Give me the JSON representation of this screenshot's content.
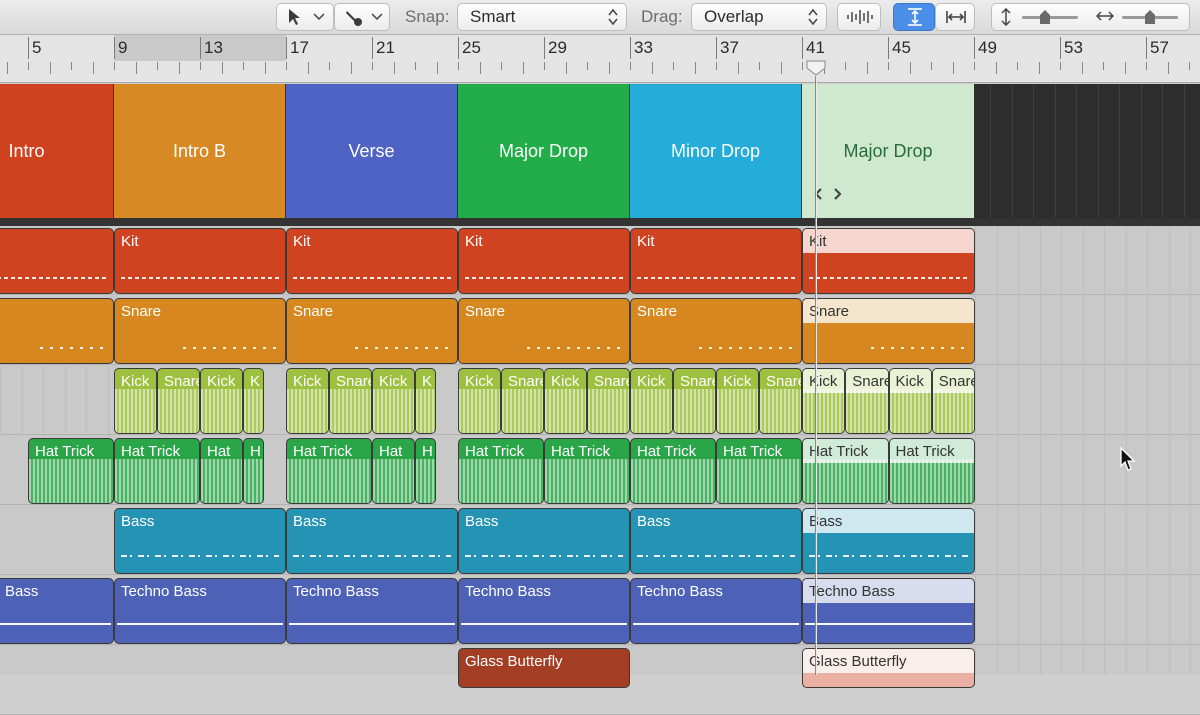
{
  "toolbar": {
    "snap_label": "Snap:",
    "snap_value": "Smart",
    "drag_label": "Drag:",
    "drag_value": "Overlap",
    "pointer_tool_icon": "pointer-icon",
    "pencil_tool_icon": "pencil-icon",
    "waveform_zoom_icon": "waveform-icon",
    "vertical_fit_icon": "vertical-fit-icon",
    "horizontal_fit_icon": "horizontal-fit-icon",
    "vertical_zoom_icon": "vertical-zoom-icon",
    "horizontal_zoom_icon": "horizontal-zoom-icon",
    "accent_color": "#4a8ee8"
  },
  "ruler": {
    "bars": [
      "5",
      "9",
      "13",
      "17",
      "21",
      "25",
      "29",
      "33",
      "37",
      "41",
      "45",
      "49",
      "53",
      "57"
    ],
    "playhead_bar": "41"
  },
  "arrangement": {
    "markers": [
      {
        "label": "Intro",
        "color": "#d0421f"
      },
      {
        "label": "Intro B",
        "color": "#d78a24"
      },
      {
        "label": "Verse",
        "color": "#4e63c4"
      },
      {
        "label": "Major Drop",
        "color": "#22ad49"
      },
      {
        "label": "Minor Drop",
        "color": "#25acd8"
      },
      {
        "label": "Major Drop",
        "color": "#cfe9cf"
      }
    ]
  },
  "tracks": {
    "kit": {
      "label": "Kit",
      "color": "#cf4320"
    },
    "snare": {
      "label": "Snare",
      "color": "#d6871f"
    },
    "kick_snare": {
      "kick": "Kick",
      "snare": "Snare",
      "k": "K",
      "color": "#9ec040"
    },
    "hat_trick": {
      "label": "Hat Trick",
      "hat": "Hat",
      "h": "H",
      "color": "#2aa548"
    },
    "bass": {
      "label": "Bass",
      "color": "#2593b3"
    },
    "techno_bass": {
      "label": "Techno Bass",
      "short": "Bass",
      "color": "#4d61b6"
    },
    "glass_butterfly": {
      "label": "Glass Butterfly",
      "color": "#a33d24"
    }
  }
}
